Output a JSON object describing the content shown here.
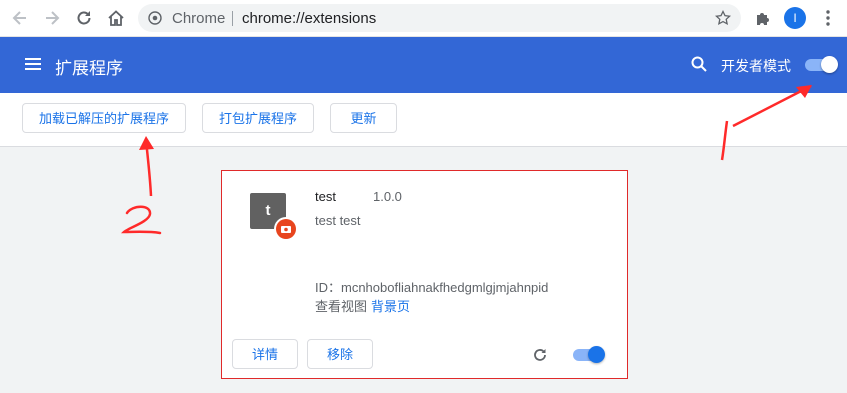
{
  "browser": {
    "omnibox_chip": "Chrome",
    "url": "chrome://extensions",
    "avatar_initial": "I"
  },
  "header": {
    "title": "扩展程序",
    "dev_mode_label": "开发者模式",
    "dev_mode_on": true,
    "color": "#3367d6"
  },
  "action_bar": {
    "load_unpacked": "加载已解压的扩展程序",
    "pack": "打包扩展程序",
    "update": "更新"
  },
  "extension": {
    "icon_letter": "t",
    "name": "test",
    "version": "1.0.0",
    "description": "test test",
    "id": "ID：mcnhobofliahnakfhedgmlgjmjahnpid",
    "inspect_label": "查看视图",
    "background_page": "背景页",
    "details_button": "详情",
    "remove_button": "移除",
    "enabled": true
  },
  "annotations": {
    "label_1": "1",
    "label_2": "2",
    "color": "#ff2a2a"
  }
}
